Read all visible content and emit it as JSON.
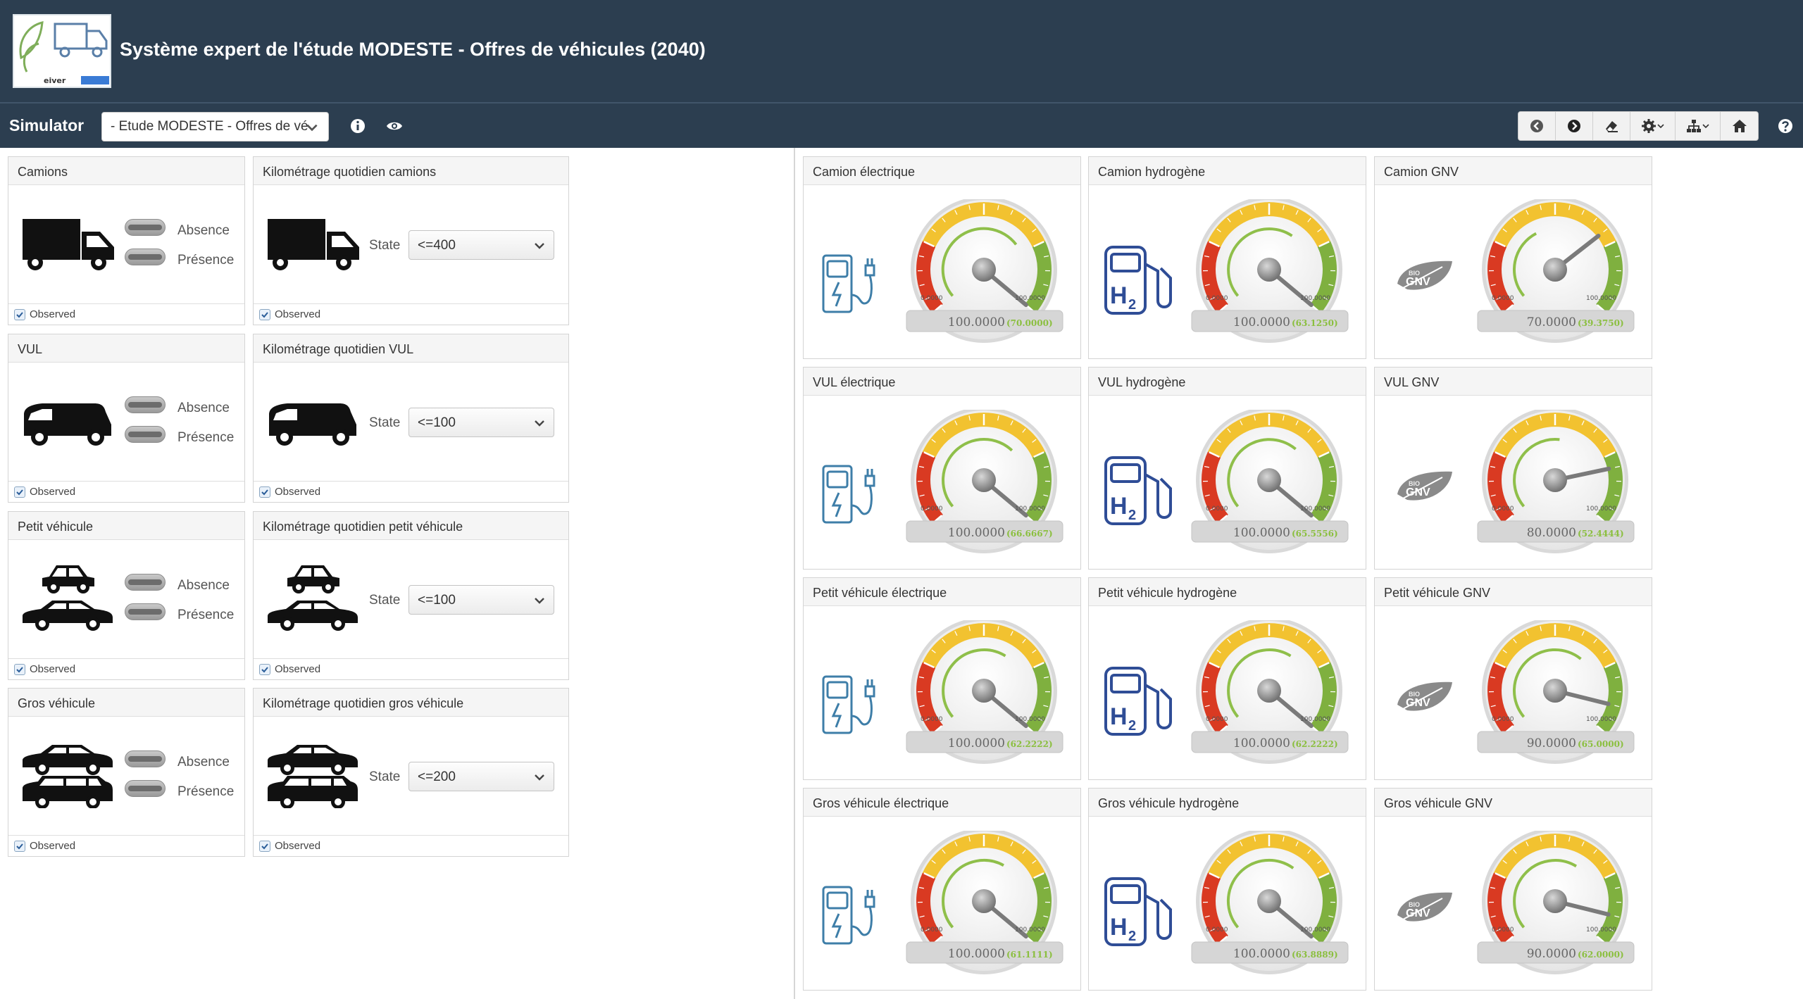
{
  "header": {
    "title": "Système expert de l'étude MODESTE - Offres de véhicules (2040)"
  },
  "toolbar": {
    "label": "Simulator",
    "study_select": "- Etude MODESTE - Offres de vé"
  },
  "colors": {
    "header_bg": "#2c3e50",
    "gauge_red": "#d93a22",
    "gauge_yellow": "#f2c230",
    "gauge_green": "#7fb03f",
    "value_green": "#8bbf3f"
  },
  "left_panels": [
    {
      "title": "Camions",
      "vehicle": "truck",
      "absence_label": "Absence",
      "presence_label": "Présence",
      "observed": "Observed"
    },
    {
      "title": "VUL",
      "vehicle": "van",
      "absence_label": "Absence",
      "presence_label": "Présence",
      "observed": "Observed"
    },
    {
      "title": "Petit véhicule",
      "vehicle": "small-cars",
      "absence_label": "Absence",
      "presence_label": "Présence",
      "observed": "Observed"
    },
    {
      "title": "Gros véhicule",
      "vehicle": "big-cars",
      "absence_label": "Absence",
      "presence_label": "Présence",
      "observed": "Observed"
    }
  ],
  "km_panels": [
    {
      "title": "Kilométrage quotidien camions",
      "state_label": "State",
      "state_value": "<=400",
      "observed": "Observed"
    },
    {
      "title": "Kilométrage quotidien VUL",
      "state_label": "State",
      "state_value": "<=100",
      "observed": "Observed"
    },
    {
      "title": "Kilométrage quotidien petit véhicule",
      "state_label": "State",
      "state_value": "<=100",
      "observed": "Observed"
    },
    {
      "title": "Kilométrage quotidien gros véhicule",
      "state_label": "State",
      "state_value": "<=200",
      "observed": "Observed"
    }
  ],
  "gauges": [
    {
      "title": "Camion électrique",
      "energy": "electric",
      "min": "0.0000",
      "max": "100.0000",
      "value": "100.0000",
      "sub": "(70.0000)",
      "needle": 100,
      "arc": 70
    },
    {
      "title": "Camion hydrogène",
      "energy": "hydrogen",
      "min": "0.0000",
      "max": "100.0000",
      "value": "100.0000",
      "sub": "(63.1250)",
      "needle": 100,
      "arc": 63.125
    },
    {
      "title": "Camion GNV",
      "energy": "gnv",
      "min": "0.0000",
      "max": "100.0000",
      "value": "70.0000",
      "sub": "(39.3750)",
      "needle": 70,
      "arc": 39.375
    },
    {
      "title": "VUL électrique",
      "energy": "electric",
      "min": "0.0000",
      "max": "100.0000",
      "value": "100.0000",
      "sub": "(66.6667)",
      "needle": 100,
      "arc": 66.6667
    },
    {
      "title": "VUL hydrogène",
      "energy": "hydrogen",
      "min": "0.0000",
      "max": "100.0000",
      "value": "100.0000",
      "sub": "(65.5556)",
      "needle": 100,
      "arc": 65.5556
    },
    {
      "title": "VUL GNV",
      "energy": "gnv",
      "min": "0.0000",
      "max": "100.0000",
      "value": "80.0000",
      "sub": "(52.4444)",
      "needle": 80,
      "arc": 52.4444
    },
    {
      "title": "Petit véhicule électrique",
      "energy": "electric",
      "min": "0.0000",
      "max": "100.0000",
      "value": "100.0000",
      "sub": "(62.2222)",
      "needle": 100,
      "arc": 62.2222
    },
    {
      "title": "Petit véhicule hydrogène",
      "energy": "hydrogen",
      "min": "0.0000",
      "max": "100.0000",
      "value": "100.0000",
      "sub": "(62.2222)",
      "needle": 100,
      "arc": 62.2222
    },
    {
      "title": "Petit véhicule GNV",
      "energy": "gnv",
      "min": "0.0000",
      "max": "100.0000",
      "value": "90.0000",
      "sub": "(65.0000)",
      "needle": 90,
      "arc": 65
    },
    {
      "title": "Gros véhicule électrique",
      "energy": "electric",
      "min": "0.0000",
      "max": "100.0000",
      "value": "100.0000",
      "sub": "(61.1111)",
      "needle": 100,
      "arc": 61.1111
    },
    {
      "title": "Gros véhicule hydrogène",
      "energy": "hydrogen",
      "min": "0.0000",
      "max": "100.0000",
      "value": "100.0000",
      "sub": "(63.8889)",
      "needle": 100,
      "arc": 63.8889
    },
    {
      "title": "Gros véhicule GNV",
      "energy": "gnv",
      "min": "0.0000",
      "max": "100.0000",
      "value": "90.0000",
      "sub": "(62.0000)",
      "needle": 90,
      "arc": 62
    }
  ]
}
